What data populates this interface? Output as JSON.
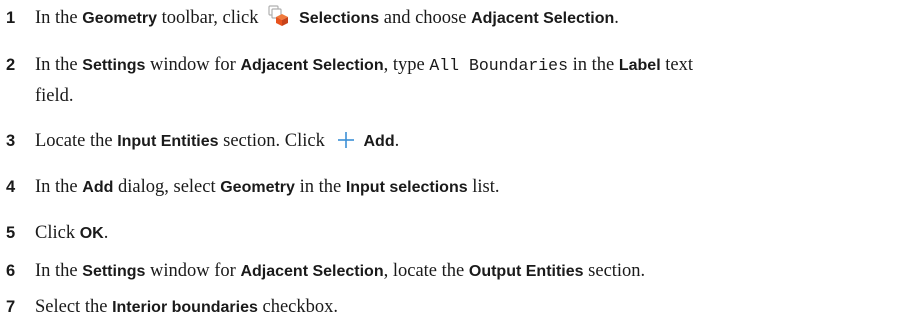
{
  "steps": [
    {
      "num": "1",
      "t1": "In the ",
      "toolbar": "Geometry",
      "t2": " toolbar, click ",
      "icon": "selections-icon",
      "button": "Selections",
      "t3": " and choose ",
      "choice": "Adjacent Selection",
      "t4": "."
    },
    {
      "num": "2",
      "t1": "In the ",
      "window": "Settings",
      "t2": " window for ",
      "node": "Adjacent Selection",
      "t3": ", type ",
      "value": "All Boundaries",
      "t4": " in the ",
      "field": "Label",
      "t5": " text",
      "t6": "field."
    },
    {
      "num": "3",
      "t1": "Locate the ",
      "section": "Input Entities",
      "t2": " section. Click ",
      "icon": "plus-icon",
      "button": "Add",
      "t3": "."
    },
    {
      "num": "4",
      "t1": "In the ",
      "dialog": "Add",
      "t2": " dialog, select ",
      "item": "Geometry",
      "t3": " in the ",
      "list": "Input selections",
      "t4": " list."
    },
    {
      "num": "5",
      "t1": "Click ",
      "button": "OK",
      "t2": "."
    },
    {
      "num": "6",
      "t1": "In the ",
      "window": "Settings",
      "t2": " window for ",
      "node": "Adjacent Selection",
      "t3": ", locate the ",
      "section": "Output Entities",
      "t4": " section."
    },
    {
      "num": "7",
      "t1": "Select the ",
      "checkbox": "Interior boundaries",
      "t2": " checkbox."
    }
  ],
  "colors": {
    "text": "#1a1a1a",
    "plus_icon": "#3c8fd6",
    "selections_icon_front": "#e8531e",
    "selections_icon_back": "#b0b0b0"
  }
}
